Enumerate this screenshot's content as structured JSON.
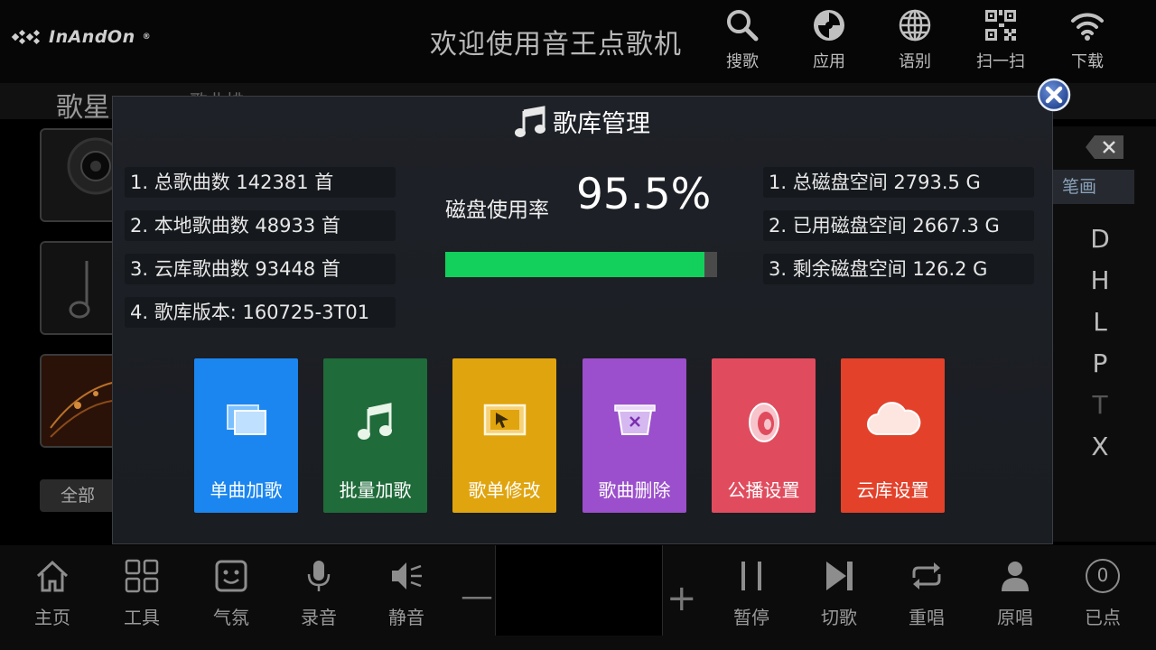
{
  "header": {
    "brand": "InAndOn",
    "brand_mark": "®",
    "title": "欢迎使用音王点歌机",
    "actions": [
      {
        "label": "搜歌",
        "icon": "search-icon"
      },
      {
        "label": "应用",
        "icon": "apps-icon"
      },
      {
        "label": "语别",
        "icon": "globe-icon"
      },
      {
        "label": "扫一扫",
        "icon": "qr-code-icon"
      },
      {
        "label": "下载",
        "icon": "wifi-icon"
      }
    ]
  },
  "background": {
    "tab_singer": "歌星",
    "tab_partial": "歌曲排",
    "filter_all": "全部",
    "stroke_tab": "笔画",
    "letters": [
      "D",
      "H",
      "L",
      "P",
      "T",
      "X"
    ]
  },
  "modal": {
    "title": "歌库管理",
    "library_stats": [
      "1. 总歌曲数 142381 首",
      "2. 本地歌曲数 48933 首",
      "3. 云库歌曲数 93448 首",
      "4. 歌库版本: 160725-3T01"
    ],
    "disk_label": "磁盘使用率",
    "disk_percent": "95.5%",
    "disk_fraction": 0.955,
    "disk_stats": [
      "1. 总磁盘空间 2793.5 G",
      "2. 已用磁盘空间 2667.3 G",
      "3. 剩余磁盘空间 126.2 G"
    ],
    "tiles": [
      {
        "label": "单曲加歌",
        "icon": "windows-icon",
        "color": "#1b86f0"
      },
      {
        "label": "批量加歌",
        "icon": "music-note-icon",
        "color": "#1f6b3a"
      },
      {
        "label": "歌单修改",
        "icon": "edit-cursor-icon",
        "color": "#e0a40e"
      },
      {
        "label": "歌曲删除",
        "icon": "delete-box-icon",
        "color": "#9b4fcc"
      },
      {
        "label": "公播设置",
        "icon": "speaker-icon",
        "color": "#e04c5e"
      },
      {
        "label": "云库设置",
        "icon": "cloud-icon",
        "color": "#e3412a"
      }
    ]
  },
  "footer": {
    "left": [
      {
        "label": "主页",
        "icon": "home-icon"
      },
      {
        "label": "工具",
        "icon": "tools-icon"
      },
      {
        "label": "气氛",
        "icon": "mood-icon"
      },
      {
        "label": "录音",
        "icon": "microphone-icon"
      },
      {
        "label": "静音",
        "icon": "mute-icon"
      }
    ],
    "right": [
      {
        "label": "暂停",
        "icon": "pause-icon"
      },
      {
        "label": "切歌",
        "icon": "skip-icon"
      },
      {
        "label": "重唱",
        "icon": "repeat-icon"
      },
      {
        "label": "原唱",
        "icon": "user-icon"
      },
      {
        "label": "已点",
        "icon": "queue-count-icon"
      }
    ],
    "queue_count": "0",
    "volume_minus": "—",
    "volume_plus": "+"
  }
}
